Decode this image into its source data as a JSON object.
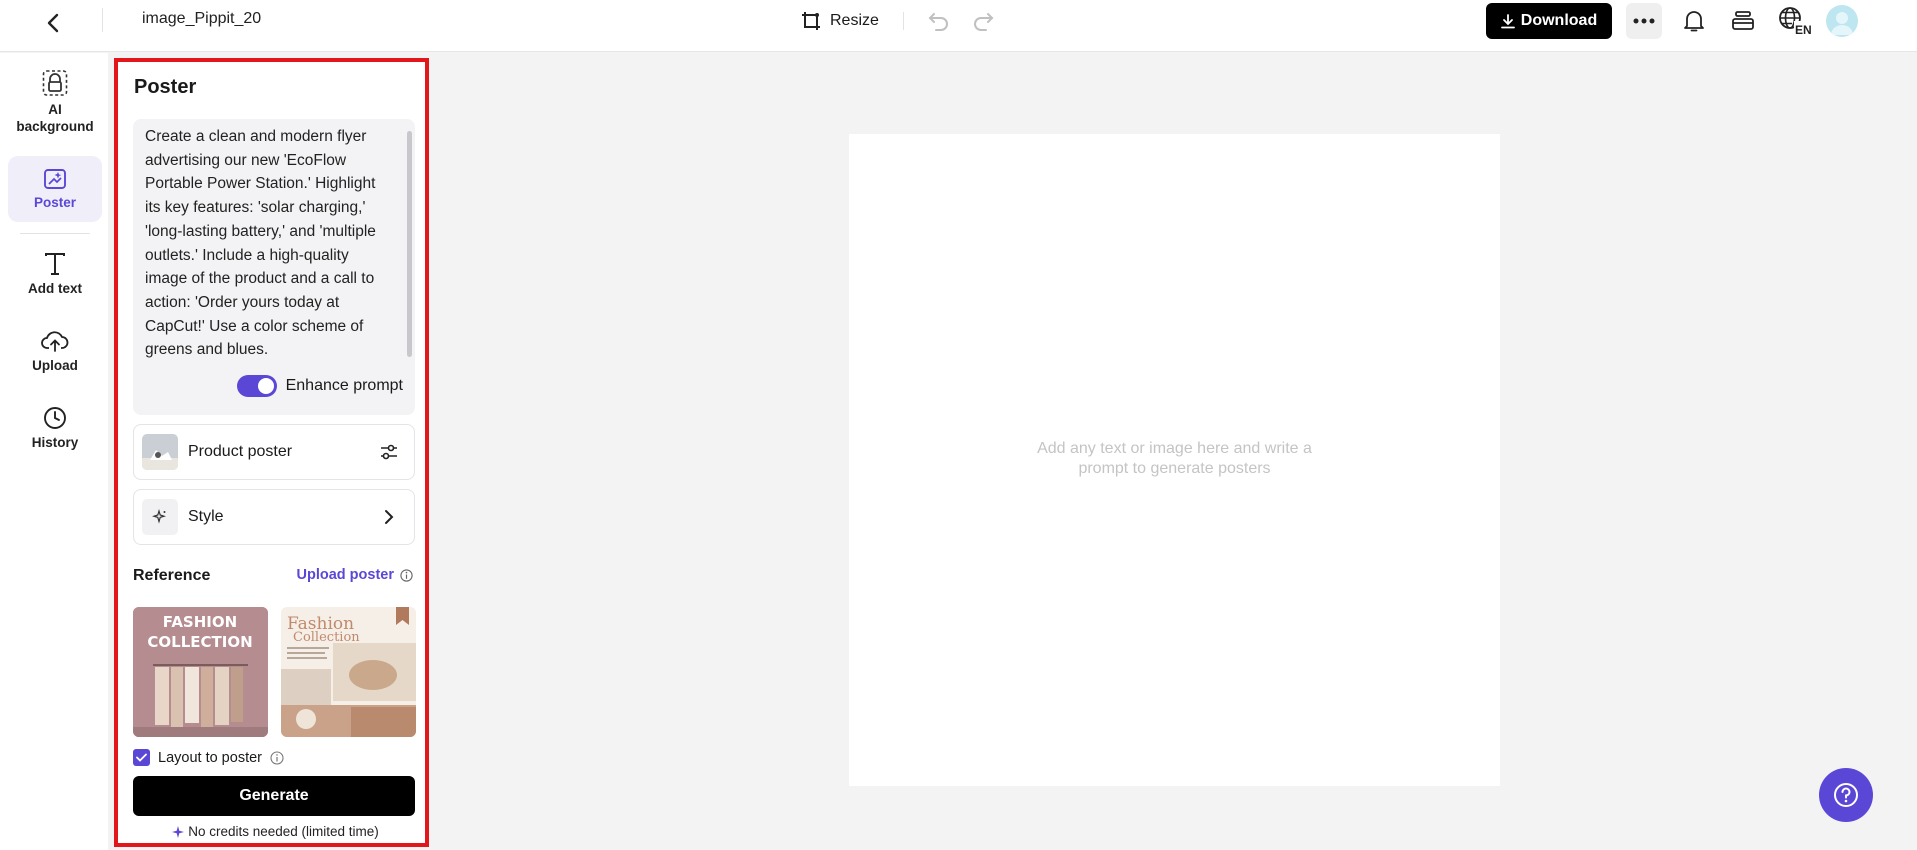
{
  "header": {
    "file_name": "image_Pippit_20",
    "resize_label": "Resize",
    "download_label": "Download",
    "lang_label": "EN"
  },
  "rail": {
    "items": [
      {
        "label": "AI background",
        "icon": "ai-background-icon"
      },
      {
        "label": "Poster",
        "icon": "poster-icon",
        "active": true
      },
      {
        "label": "Add text",
        "icon": "text-icon"
      },
      {
        "label": "Upload",
        "icon": "upload-icon"
      },
      {
        "label": "History",
        "icon": "history-icon"
      }
    ]
  },
  "panel": {
    "title": "Poster",
    "prompt": "Create a clean and modern flyer\nadvertising our new 'EcoFlow\nPortable Power Station.' Highlight\nits key features: 'solar charging,'\n'long-lasting battery,' and 'multiple\noutlets.' Include a high-quality\nimage of the product and a call to\naction: 'Order yours today at\nCapCut!' Use a color scheme of\ngreens and blues.",
    "enhance_label": "Enhance prompt",
    "enhance_on": true,
    "product_poster_label": "Product poster",
    "style_label": "Style",
    "reference_title": "Reference",
    "upload_poster_label": "Upload poster",
    "ref1_title_a": "FASHION",
    "ref1_title_b": "COLLECTION",
    "ref2_title_a": "Fashion",
    "ref2_title_b": "Collection",
    "layout_label": "Layout to poster",
    "layout_checked": true,
    "generate_label": "Generate",
    "credits_label": "No credits needed (limited time)"
  },
  "canvas": {
    "hint_line1": "Add any text or image here and write a",
    "hint_line2": "prompt to generate posters"
  },
  "colors": {
    "accent": "#5b47d6",
    "highlight_border": "#e3161b"
  }
}
